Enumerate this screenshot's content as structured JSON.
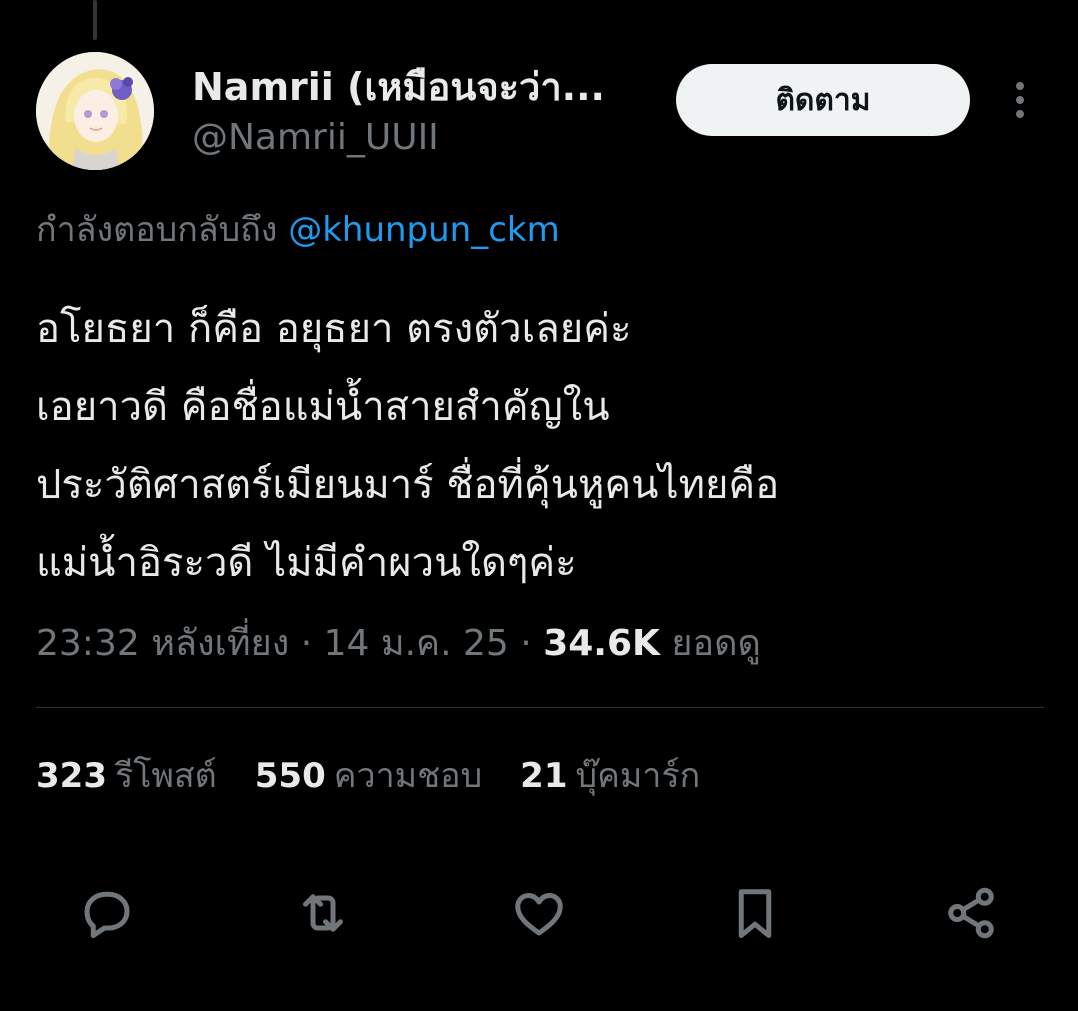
{
  "tweet": {
    "author_name": "Namrii (เหมือนจะว่า...",
    "author_handle": "@Namrii_UUII",
    "follow_label": "ติดตาม",
    "reply_prefix": "กำลังตอบกลับถึง",
    "reply_to": "@khunpun_ckm",
    "text_lines": [
      "อโยธยา ก็คือ อยุธยา ตรงตัวเลยค่ะ",
      "เอยาวดี คือชื่อแม่น้ำสายสำคัญใน",
      "ประวัติศาสตร์เมียนมาร์ ชื่อที่คุ้นหูคนไทยคือ",
      "แม่น้ำอิระวดี ไม่มีคำผวนใดๆค่ะ"
    ],
    "time": "23:32 หลังเที่ยง",
    "separator": "·",
    "date": "14 ม.ค. 25",
    "views_count": "34.6K",
    "views_label": "ยอดดู"
  },
  "stats": {
    "retweets_count": "323",
    "retweets_label": "รีโพสต์",
    "likes_count": "550",
    "likes_label": "ความชอบ",
    "bookmarks_count": "21",
    "bookmarks_label": "บุ๊คมาร์ก"
  },
  "icons": {
    "more": "more-vertical-icon",
    "reply": "reply-icon",
    "retweet": "retweet-icon",
    "like": "heart-icon",
    "bookmark": "bookmark-icon",
    "share": "share-icon"
  },
  "colors": {
    "background": "#000000",
    "text_primary": "#e7e9ea",
    "text_secondary": "#71767b",
    "link": "#1d9bf0",
    "follow_button_bg": "#eff3f4",
    "divider": "#2f3336"
  }
}
